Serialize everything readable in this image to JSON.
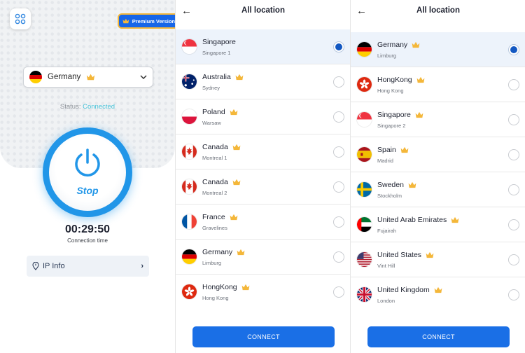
{
  "home": {
    "premium_label": "Premium Version",
    "selected_country": "Germany",
    "status_label": "Status: ",
    "status_value": "Connected",
    "power_label": "Stop",
    "timer": "00:29:50",
    "timer_label": "Connection time",
    "ip_info_label": "IP Info"
  },
  "colors": {
    "accent": "#1A6FE6",
    "connected": "#47C2D8",
    "crown": "#F4B73A"
  },
  "screen1": {
    "title": "All location",
    "connect_label": "CONNECT",
    "rows": [
      {
        "country": "Singapore",
        "city": "Singapore 1",
        "flag": "sg",
        "premium": false,
        "selected": true
      },
      {
        "country": "Australia",
        "city": "Sydney",
        "flag": "au",
        "premium": true,
        "selected": false
      },
      {
        "country": "Poland",
        "city": "Warsaw",
        "flag": "pl",
        "premium": true,
        "selected": false
      },
      {
        "country": "Canada",
        "city": "Montreal 1",
        "flag": "ca",
        "premium": true,
        "selected": false
      },
      {
        "country": "Canada",
        "city": "Montreal 2",
        "flag": "ca",
        "premium": true,
        "selected": false
      },
      {
        "country": "France",
        "city": "Gravelines",
        "flag": "fr",
        "premium": true,
        "selected": false
      },
      {
        "country": "Germany",
        "city": "Limburg",
        "flag": "de",
        "premium": true,
        "selected": false
      },
      {
        "country": "HongKong",
        "city": "Hong Kong",
        "flag": "hk",
        "premium": true,
        "selected": false
      }
    ]
  },
  "screen2": {
    "title": "All location",
    "connect_label": "CONNECT",
    "rows": [
      {
        "country": "Germany",
        "city": "Limburg",
        "flag": "de",
        "premium": true,
        "selected": true
      },
      {
        "country": "HongKong",
        "city": "Hong Kong",
        "flag": "hk",
        "premium": true,
        "selected": false
      },
      {
        "country": "Singapore",
        "city": "Singapore 2",
        "flag": "sg",
        "premium": true,
        "selected": false
      },
      {
        "country": "Spain",
        "city": "Madrid",
        "flag": "es",
        "premium": true,
        "selected": false
      },
      {
        "country": "Sweden",
        "city": "Stockholm",
        "flag": "se",
        "premium": true,
        "selected": false
      },
      {
        "country": "United Arab Emirates",
        "city": "Fujairah",
        "flag": "ae",
        "premium": true,
        "selected": false
      },
      {
        "country": "United States",
        "city": "Vint Hill",
        "flag": "us",
        "premium": true,
        "selected": false
      },
      {
        "country": "United Kingdom",
        "city": "London",
        "flag": "gb",
        "premium": true,
        "selected": false
      }
    ]
  }
}
